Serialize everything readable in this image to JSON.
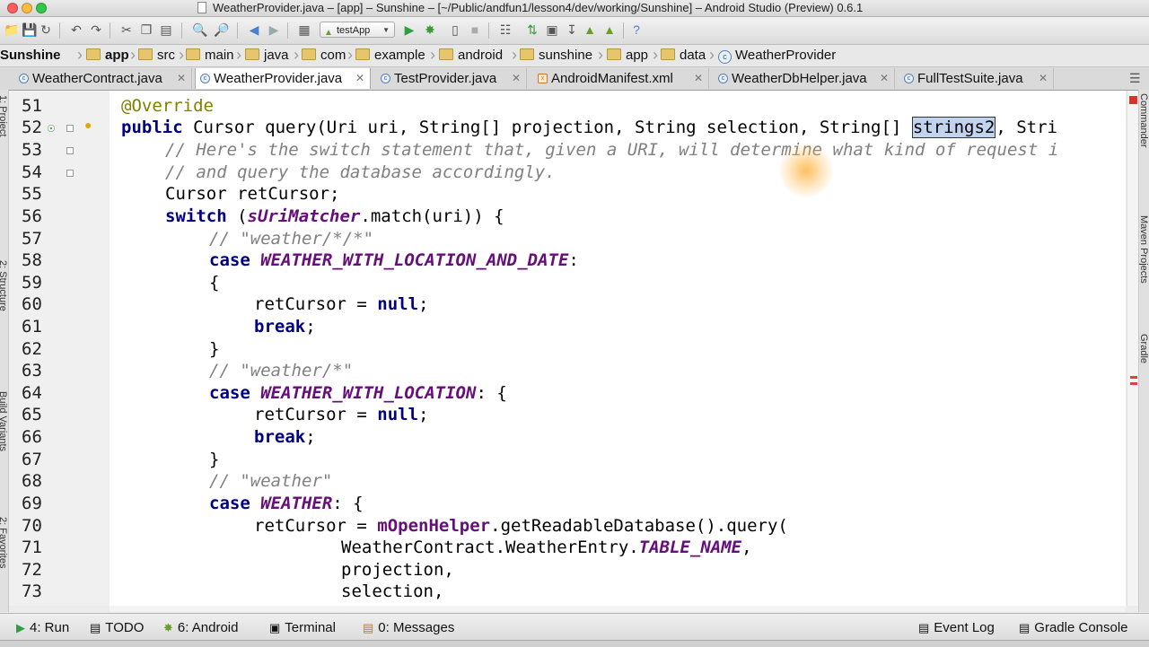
{
  "window": {
    "title": "WeatherProvider.java – [app] – Sunshine – [~/Public/andfun1/lesson4/dev/working/Sunshine] – Android Studio (Preview) 0.6.1"
  },
  "toolbar": {
    "run_config": "testApp"
  },
  "breadcrumb": [
    "Sunshine",
    "app",
    "src",
    "main",
    "java",
    "com",
    "example",
    "android",
    "sunshine",
    "app",
    "data",
    "WeatherProvider"
  ],
  "tabs": [
    {
      "label": "WeatherContract.java",
      "active": false
    },
    {
      "label": "WeatherProvider.java",
      "active": true
    },
    {
      "label": "TestProvider.java",
      "active": false
    },
    {
      "label": "AndroidManifest.xml",
      "active": false
    },
    {
      "label": "WeatherDbHelper.java",
      "active": false
    },
    {
      "label": "FullTestSuite.java",
      "active": false
    }
  ],
  "line_numbers": [
    "51",
    "52",
    "53",
    "54",
    "55",
    "56",
    "57",
    "58",
    "59",
    "60",
    "61",
    "62",
    "63",
    "64",
    "65",
    "66",
    "67",
    "68",
    "69",
    "70",
    "71",
    "72",
    "73"
  ],
  "code": {
    "l51": "@Override",
    "l52a": "public",
    "l52b": " Cursor query(Uri uri, String[] projection, String selection, String[] ",
    "l52c": "strings2",
    "l52d": ", Stri",
    "l53": "// Here's the switch statement that, given a URI, will determine what kind of request i",
    "l54": "// and query the database accordingly.",
    "l55": "Cursor retCursor;",
    "l56a": "switch",
    "l56b": " (",
    "l56c": "sUriMatcher",
    "l56d": ".match(uri)) {",
    "l57": "// \"weather/*/*\"",
    "l58a": "case",
    "l58b": "WEATHER_WITH_LOCATION_AND_DATE",
    "l58c": ":",
    "l59": "{",
    "l60a": "retCursor = ",
    "l60b": "null",
    "l60c": ";",
    "l61a": "break",
    "l61b": ";",
    "l62": "}",
    "l63": "// \"weather/*\"",
    "l64a": "case",
    "l64b": "WEATHER_WITH_LOCATION",
    "l64c": ": {",
    "l65a": "retCursor = ",
    "l65b": "null",
    "l65c": ";",
    "l66a": "break",
    "l66b": ";",
    "l67": "}",
    "l68": "// \"weather\"",
    "l69a": "case",
    "l69b": "WEATHER",
    "l69c": ": {",
    "l70a": "retCursor = ",
    "l70b": "mOpenHelper",
    "l70c": ".getReadableDatabase().query(",
    "l71a": "WeatherContract.WeatherEntry.",
    "l71b": "TABLE_NAME",
    "l71c": ",",
    "l72": "projection,",
    "l73": "selection,"
  },
  "bottom_tools": [
    {
      "label": "4: Run"
    },
    {
      "label": "TODO"
    },
    {
      "label": "6: Android"
    },
    {
      "label": "Terminal"
    },
    {
      "label": "0: Messages"
    },
    {
      "label": "Event Log"
    },
    {
      "label": "Gradle Console"
    }
  ],
  "side_labels": {
    "left": [
      "1: Project",
      "2: Structure",
      "Build Variants",
      "2: Favorites"
    ],
    "right": [
      "Commander",
      "Maven Projects",
      "Gradle"
    ]
  }
}
